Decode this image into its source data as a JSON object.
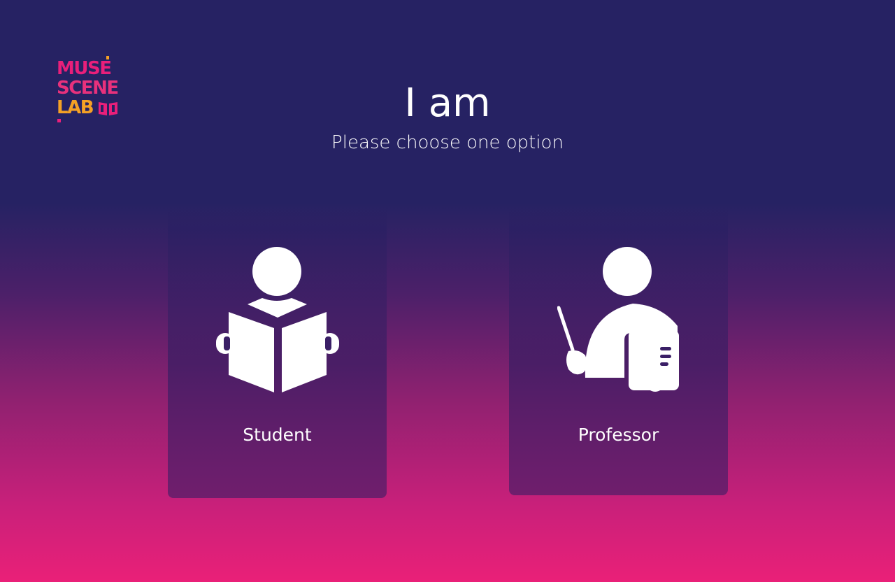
{
  "brand": {
    "logo_lines": [
      "MUSE",
      "SCENE",
      "LAB"
    ]
  },
  "page": {
    "title": "I am",
    "subtitle": "Please choose one option"
  },
  "options": [
    {
      "label": "Student",
      "icon": "student-reading-icon"
    },
    {
      "label": "Professor",
      "icon": "professor-pointer-icon"
    }
  ],
  "colors": {
    "background_top": "#262263",
    "background_bottom": "#ea2078",
    "logo_pink": "#e91f7a",
    "logo_orange": "#f5a125",
    "text": "#ffffff"
  }
}
